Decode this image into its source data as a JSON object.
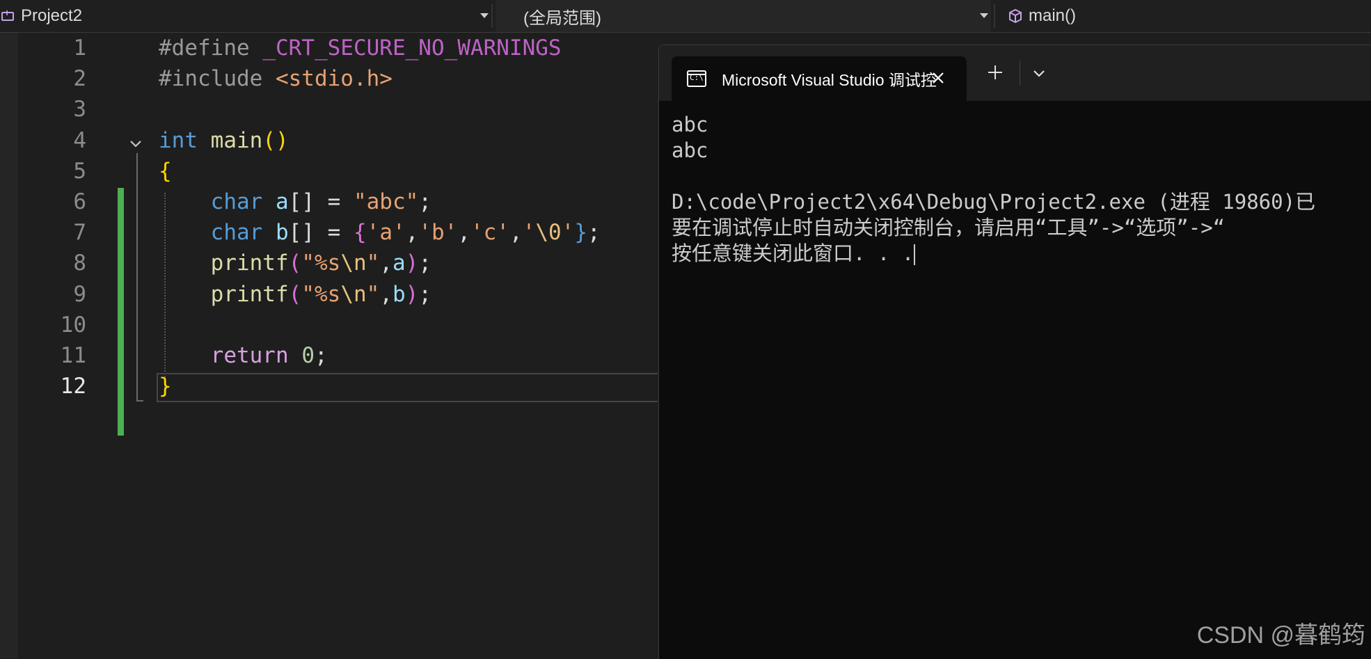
{
  "navbar": {
    "project": "Project2",
    "scope": "(全局范围)",
    "function": "main()"
  },
  "editor": {
    "line_numbers": [
      "1",
      "2",
      "3",
      "4",
      "5",
      "6",
      "7",
      "8",
      "9",
      "10",
      "11",
      "12"
    ],
    "current_line": "12",
    "code": {
      "l1_directive": "#define",
      "l1_macro": "_CRT_SECURE_NO_WARNINGS",
      "l2_directive": "#include",
      "l2_header": "<stdio.h>",
      "l4_type": "int",
      "l4_name": "main",
      "l4_parens": "()",
      "l5_brace": "{",
      "l6_type": "char",
      "l6_var": "a",
      "l6_rest": "[] = ",
      "l6_str": "\"abc\"",
      "l6_end": ";",
      "l7_type": "char",
      "l7_var": "b",
      "l7_rest": "[] = ",
      "l7_open": "{",
      "l7_a": "'a'",
      "l7_b": "'b'",
      "l7_c": "'c'",
      "l7_zero_q1": "'",
      "l7_zero_esc": "\\0",
      "l7_zero_q2": "'",
      "l7_close": "}",
      "l7_end": ";",
      "l8_fn": "printf",
      "l8_str_a": "\"%s",
      "l8_esc": "\\n",
      "l8_str_b": "\"",
      "l8_arg": "a",
      "l9_fn": "printf",
      "l9_str_a": "\"%s",
      "l9_esc": "\\n",
      "l9_str_b": "\"",
      "l9_arg": "b",
      "l11_kw": "return",
      "l11_num": "0",
      "l12_brace": "}"
    }
  },
  "terminal": {
    "tab_title": "Microsoft Visual Studio 调试控",
    "lines": [
      "abc",
      "abc",
      "",
      "D:\\code\\Project2\\x64\\Debug\\Project2.exe (进程 19860)已",
      "要在调试停止时自动关闭控制台，请启用“工具”->“选项”->“",
      "按任意键关闭此窗口. . ."
    ]
  },
  "watermark": "CSDN @暮鹤筠",
  "colors": {
    "change_bar": "#4caf50",
    "keyword": "#569cd6",
    "function": "#dcdcaa",
    "string": "#e8a272",
    "macro": "#bd63c5"
  }
}
